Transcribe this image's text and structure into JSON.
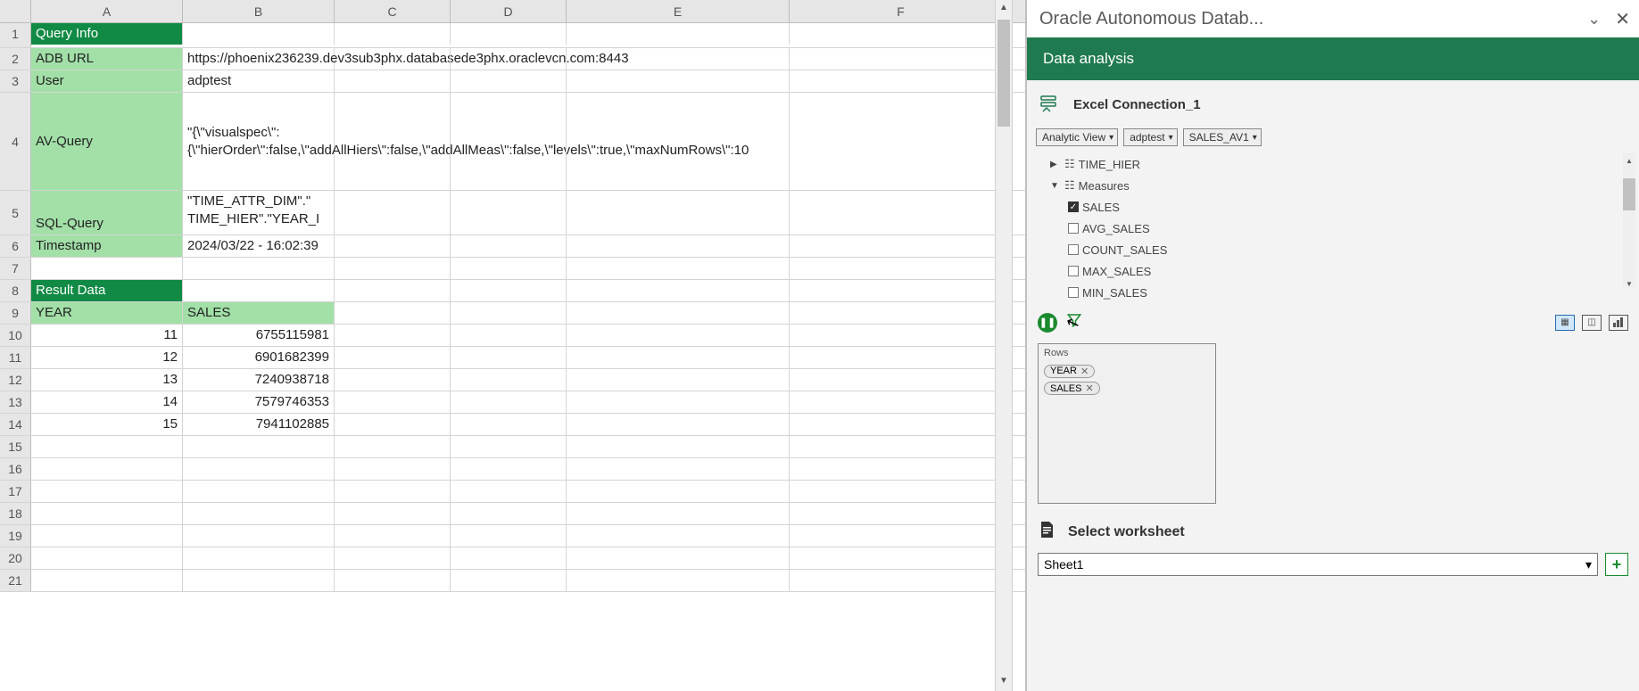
{
  "columns": [
    "A",
    "B",
    "C",
    "D",
    "E",
    "F"
  ],
  "row_numbers": [
    1,
    2,
    3,
    4,
    5,
    6,
    7,
    8,
    9,
    10,
    11,
    12,
    13,
    14,
    15,
    16,
    17,
    18,
    19,
    20,
    21
  ],
  "cells": {
    "r1a": "Query Info",
    "r2a": "ADB URL",
    "r2b": "https://phoenix236239.dev3sub3phx.databasede3phx.oraclevcn.com:8443",
    "r3a": "User",
    "r3b": "adptest",
    "r4a": "AV-Query",
    "r4b": "\"{\\\"visualspec\\\":{\\\"hierOrder\\\":false,\\\"addAllHiers\\\":false,\\\"addAllMeas\\\":false,\\\"levels\\\":true,\\\"maxNumRows\\\":10",
    "r5a": "SQL-Query",
    "r5b": "\"TIME_ATTR_DIM\".\"\nTIME_HIER\".\"YEAR_I",
    "r6a": "Timestamp",
    "r6b": "2024/03/22 - 16:02:39",
    "r8a": "Result Data",
    "r9a": "YEAR",
    "r9b": "SALES",
    "r10a": "11",
    "r10b": "6755115981",
    "r11a": "12",
    "r11b": "6901682399",
    "r12a": "13",
    "r12b": "7240938718",
    "r13a": "14",
    "r13b": "7579746353",
    "r14a": "15",
    "r14b": "7941102885"
  },
  "pane": {
    "title": "Oracle Autonomous Datab...",
    "subtitle": "Data analysis",
    "connection": "Excel Connection_1",
    "select_view": "Analytic View",
    "select_schema": "adptest",
    "select_av": "SALES_AV1",
    "tree": {
      "node1": "TIME_HIER",
      "node2": "Measures",
      "m1": "SALES",
      "m2": "AVG_SALES",
      "m3": "COUNT_SALES",
      "m4": "MAX_SALES",
      "m5": "MIN_SALES"
    },
    "rows_label": "Rows",
    "tag_year": "YEAR",
    "tag_sales": "SALES",
    "select_ws_label": "Select worksheet",
    "ws_value": "Sheet1"
  }
}
